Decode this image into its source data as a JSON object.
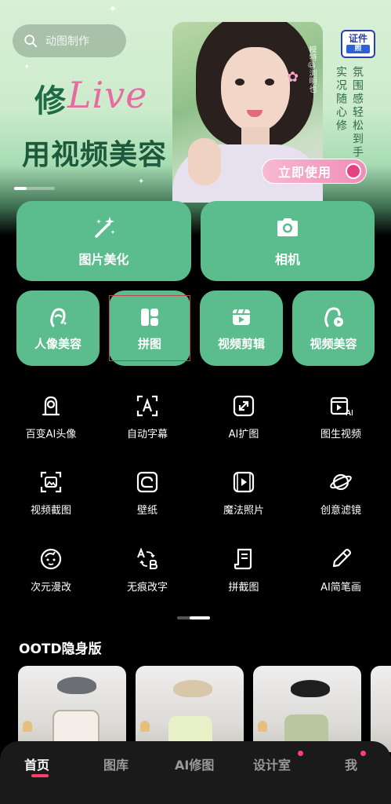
{
  "search": {
    "placeholder": "动图制作"
  },
  "banner": {
    "slogan_prefix": "修",
    "slogan_live": "Live",
    "slogan_main": "用视频美容",
    "vertical_1": "实况随心修",
    "vertical_2": "氛围感轻松到手",
    "badge_top": "证件",
    "badge_bottom": "照",
    "photo_tag": "模特@浏明也",
    "button": "立即使用",
    "sparkle_glyph": "✦"
  },
  "tiles_large": [
    {
      "label": "图片美化",
      "icon": "magic-wand-icon"
    },
    {
      "label": "相机",
      "icon": "camera-icon"
    }
  ],
  "tiles_small": [
    {
      "label": "人像美容",
      "icon": "portrait-icon"
    },
    {
      "label": "拼图",
      "icon": "collage-icon"
    },
    {
      "label": "视频剪辑",
      "icon": "video-edit-icon"
    },
    {
      "label": "视频美容",
      "icon": "video-beauty-icon"
    }
  ],
  "tools": [
    {
      "label": "百变AI头像",
      "icon": "ai-avatar-icon"
    },
    {
      "label": "自动字幕",
      "icon": "auto-subtitle-icon"
    },
    {
      "label": "AI扩图",
      "icon": "ai-expand-icon"
    },
    {
      "label": "图生视频",
      "icon": "image-to-video-icon"
    },
    {
      "label": "视频截图",
      "icon": "video-screenshot-icon"
    },
    {
      "label": "壁纸",
      "icon": "wallpaper-icon"
    },
    {
      "label": "魔法照片",
      "icon": "magic-photo-icon"
    },
    {
      "label": "创意滤镜",
      "icon": "creative-filter-icon"
    },
    {
      "label": "次元漫改",
      "icon": "anime-icon"
    },
    {
      "label": "无痕改字",
      "icon": "text-edit-icon"
    },
    {
      "label": "拼截图",
      "icon": "long-screenshot-icon"
    },
    {
      "label": "AI简笔画",
      "icon": "ai-sketch-icon"
    }
  ],
  "section": {
    "title": "OOTD隐身版"
  },
  "nav": {
    "items": [
      {
        "label": "首页",
        "active": true,
        "dot": false
      },
      {
        "label": "图库",
        "active": false,
        "dot": false
      },
      {
        "label": "AI修图",
        "active": false,
        "dot": false
      },
      {
        "label": "设计室",
        "active": false,
        "dot": true
      },
      {
        "label": "我",
        "active": false,
        "dot": true
      }
    ]
  },
  "colors": {
    "tile": "#5bbd8e",
    "accent": "#ff3e6c",
    "highlight": "#c44343"
  }
}
